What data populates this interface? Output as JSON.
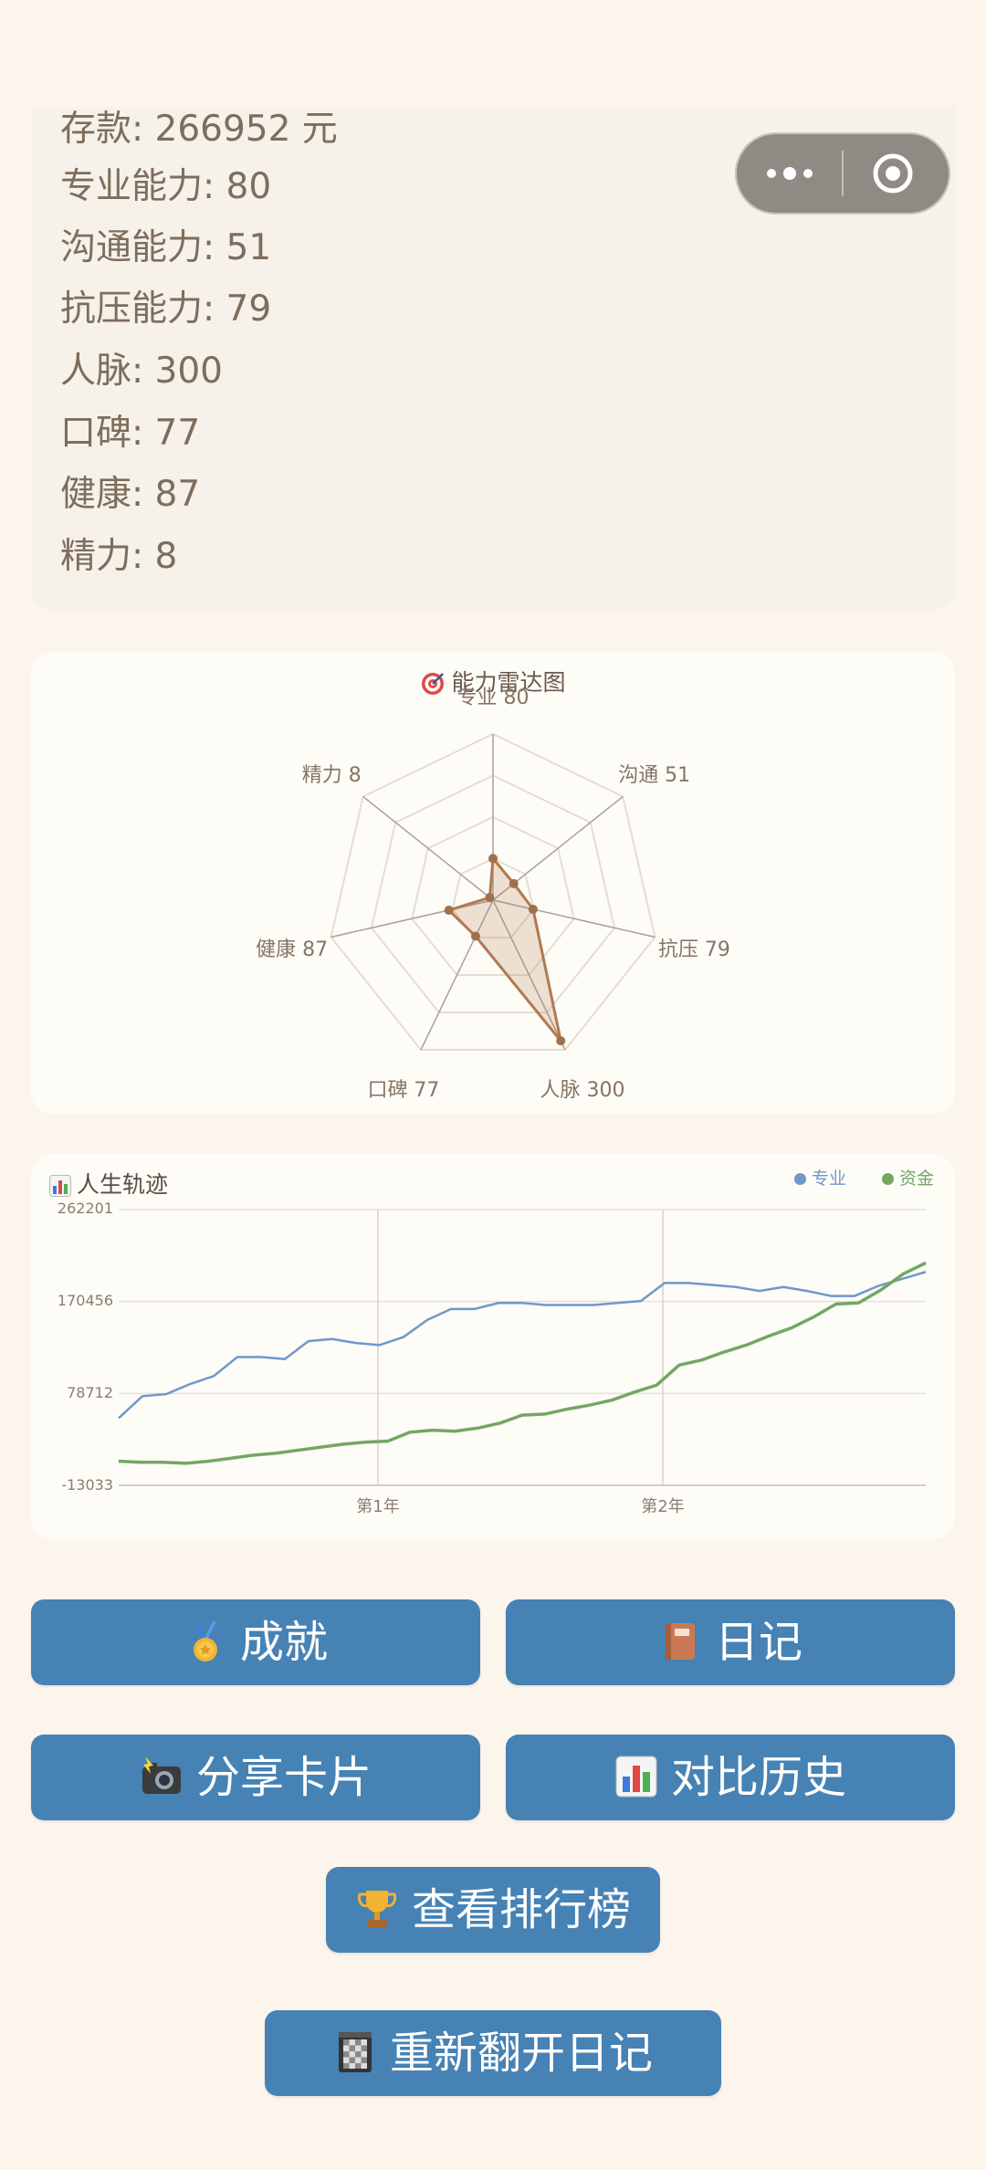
{
  "stats": [
    {
      "label": "存款: 266952 元"
    },
    {
      "label": "专业能力: 80"
    },
    {
      "label": "沟通能力: 51"
    },
    {
      "label": "抗压能力: 79"
    },
    {
      "label": "人脉: 300"
    },
    {
      "label": "口碑: 77"
    },
    {
      "label": "健康: 87"
    },
    {
      "label": "精力: 8"
    }
  ],
  "radar": {
    "title": "能力雷达图",
    "title_icon": "target-icon",
    "labels": [
      "专业 80",
      "沟通 51",
      "抗压 79",
      "人脉 300",
      "口碑 77",
      "健康 87",
      "精力 8"
    ],
    "values": [
      80,
      51,
      79,
      300,
      77,
      87,
      8
    ],
    "fill_color": "#b07a50"
  },
  "chart_data": {
    "type": "line",
    "title": "人生轨迹",
    "title_icon": "bar-chart-icon",
    "ylim": [
      -13033,
      262201
    ],
    "yticks": [
      "262201",
      "170456",
      "78712",
      "-13033"
    ],
    "xticks": [
      "第1年",
      "第2年"
    ],
    "series": [
      {
        "name": "专业",
        "color": "#6f98cc",
        "values": [
          54000,
          76000,
          78000,
          88000,
          96000,
          115000,
          115000,
          113000,
          131000,
          133000,
          129000,
          127000,
          135000,
          152000,
          163000,
          163000,
          169000,
          169000,
          167000,
          167000,
          167000,
          169000,
          171000,
          189000,
          189000,
          187000,
          185000,
          181000,
          185000,
          181000,
          176000,
          176000,
          186000,
          193000,
          200000
        ]
      },
      {
        "name": "资金",
        "color": "#72a862",
        "values": [
          11000,
          10000,
          10000,
          9000,
          11000,
          14000,
          17000,
          19000,
          22000,
          25000,
          28000,
          30000,
          31000,
          40000,
          42000,
          41000,
          44000,
          49000,
          57000,
          58000,
          63000,
          67000,
          72000,
          80000,
          87000,
          107000,
          112000,
          120000,
          127000,
          136000,
          144000,
          155000,
          168000,
          169000,
          182000,
          198000,
          209000
        ]
      }
    ]
  },
  "buttons": {
    "achievement": {
      "label": "成就",
      "icon": "medal-icon"
    },
    "diary": {
      "label": "日记",
      "icon": "book-icon"
    },
    "share": {
      "label": "分享卡片",
      "icon": "camera-flash-icon"
    },
    "compare": {
      "label": "对比历史",
      "icon": "bar-chart-icon"
    },
    "leaderboard": {
      "label": "查看排行榜",
      "icon": "trophy-icon"
    },
    "reopen": {
      "label": "重新翻开日记",
      "icon": "notebook-icon"
    }
  }
}
